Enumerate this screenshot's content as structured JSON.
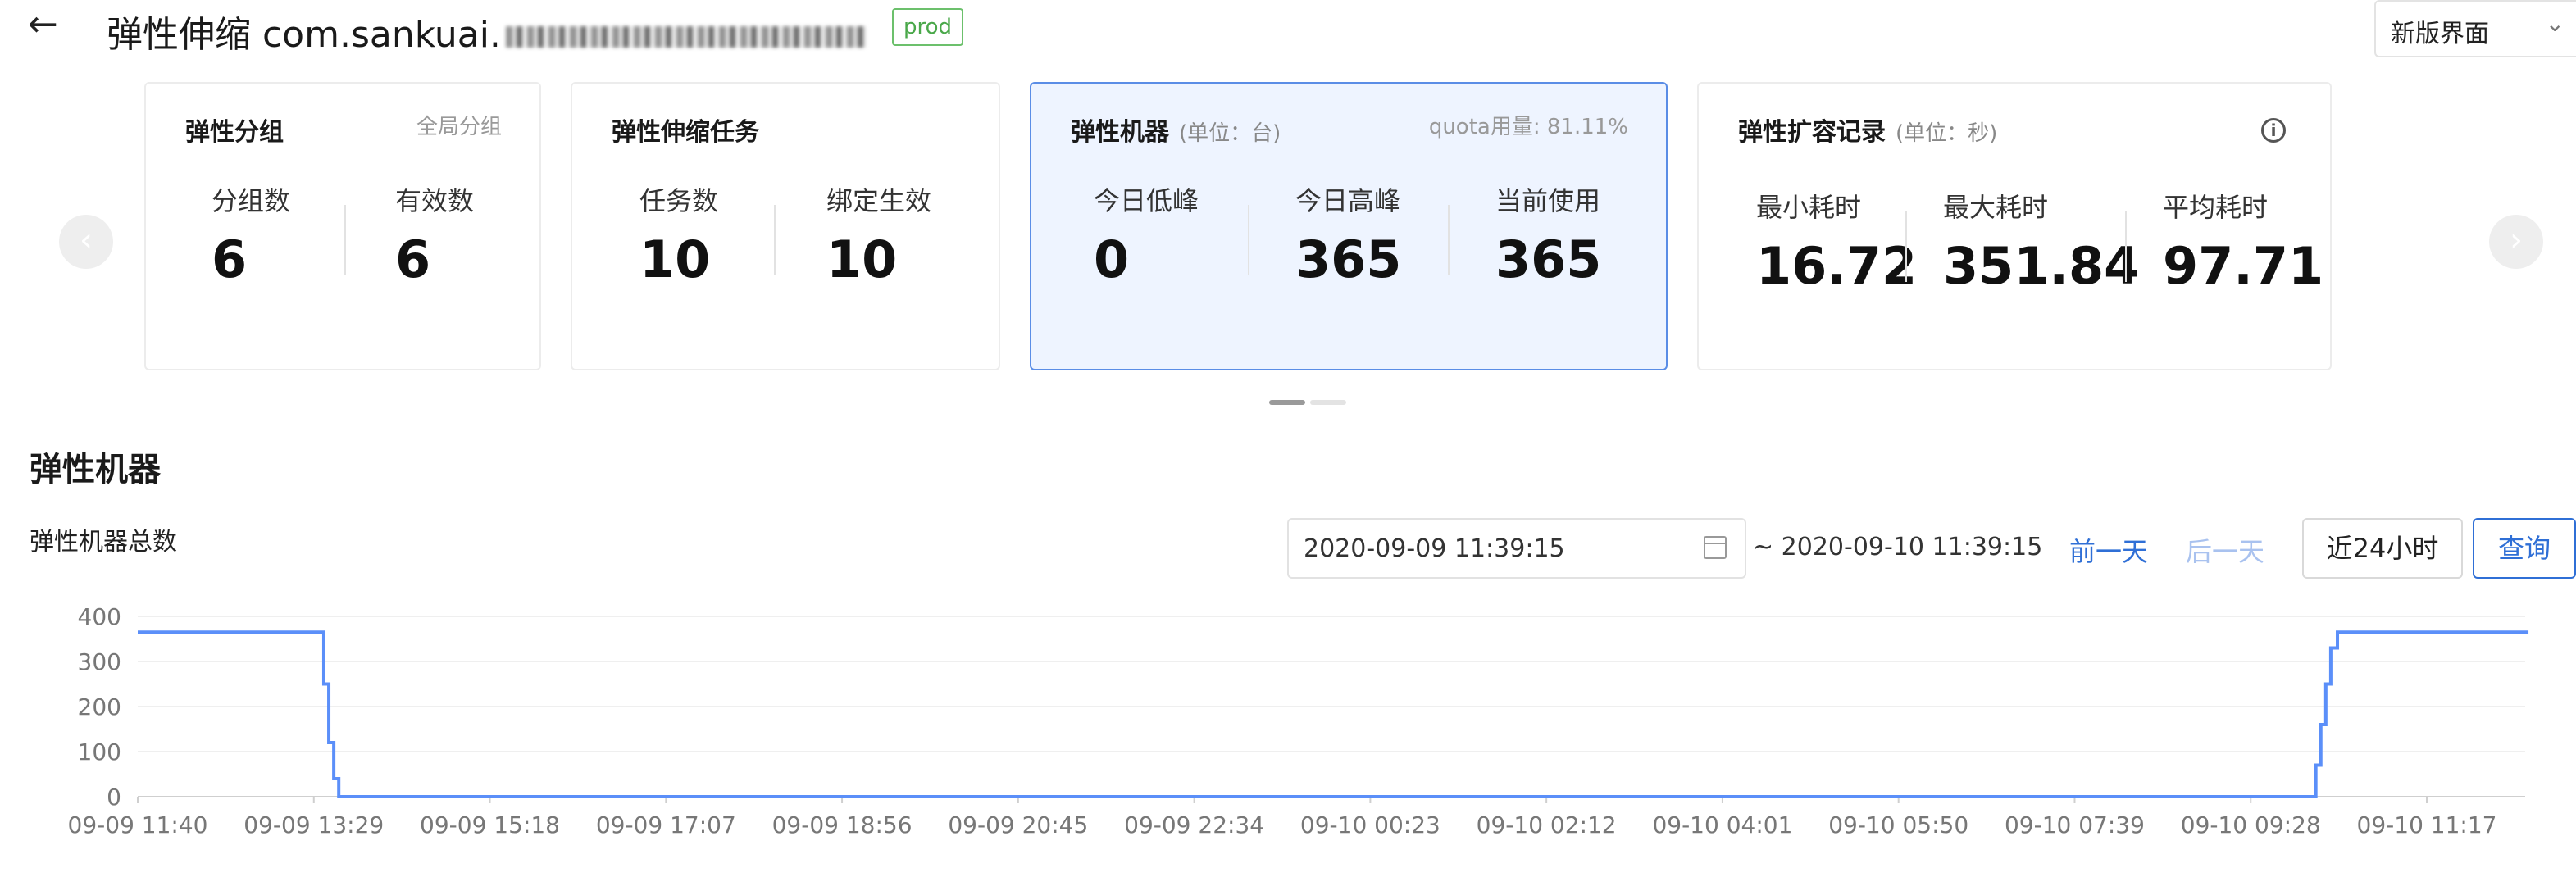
{
  "header": {
    "back_icon": "arrow-left-icon",
    "title": "弹性伸缩 com.sankuai.",
    "env_badge": "prod",
    "version_select": "新版界面"
  },
  "carousel": {
    "prev_icon": "chevron-left-icon",
    "next_icon": "chevron-right-icon",
    "cards": [
      {
        "title": "弹性分组",
        "subtitle": "全局分组",
        "metrics": [
          {
            "label": "分组数",
            "value": "6"
          },
          {
            "label": "有效数",
            "value": "6"
          }
        ]
      },
      {
        "title": "弹性伸缩任务",
        "metrics": [
          {
            "label": "任务数",
            "value": "10"
          },
          {
            "label": "绑定生效",
            "value": "10"
          }
        ]
      },
      {
        "title": "弹性机器",
        "unit": "(单位：台)",
        "subtitle": "quota用量: 81.11%",
        "metrics": [
          {
            "label": "今日低峰",
            "value": "0"
          },
          {
            "label": "今日高峰",
            "value": "365"
          },
          {
            "label": "当前使用",
            "value": "365"
          }
        ]
      },
      {
        "title": "弹性扩容记录",
        "unit": "(单位：秒)",
        "info_icon": "info-circle-icon",
        "metrics": [
          {
            "label": "最小耗时",
            "value": "16.72"
          },
          {
            "label": "最大耗时",
            "value": "351.84"
          },
          {
            "label": "平均耗时",
            "value": "97.71"
          }
        ]
      }
    ]
  },
  "section": {
    "title": "弹性机器",
    "chart_title": "弹性机器总数"
  },
  "filters": {
    "start_value": "2020-09-09 11:39:15",
    "calendar_icon": "calendar-icon",
    "range_end": "~ 2020-09-10 11:39:15",
    "prev_day": "前一天",
    "next_day": "后一天",
    "last_24h": "近24小时",
    "query": "查询"
  },
  "colors": {
    "line": "#5b8ff9",
    "accent": "#2f6fd6",
    "badge": "#4aa84a",
    "active_card_bg": "#eef4ff"
  },
  "chart_data": {
    "type": "line",
    "title": "弹性机器总数",
    "xlabel": "",
    "ylabel": "",
    "ylim": [
      0,
      400
    ],
    "yticks": [
      0,
      100,
      200,
      300,
      400
    ],
    "xticks": [
      "09-09 11:40",
      "09-09 13:29",
      "09-09 15:18",
      "09-09 17:07",
      "09-09 18:56",
      "09-09 20:45",
      "09-09 22:34",
      "09-10 00:23",
      "09-10 02:12",
      "09-10 04:01",
      "09-10 05:50",
      "09-10 07:39",
      "09-10 09:28",
      "09-10 11:17"
    ],
    "grid": true,
    "series": [
      {
        "points": [
          [
            "09-09 11:40",
            365
          ],
          [
            "09-09 13:29",
            365
          ],
          [
            "09-09 13:32",
            250
          ],
          [
            "09-09 13:35",
            120
          ],
          [
            "09-09 13:38",
            40
          ],
          [
            "09-09 13:41",
            0
          ],
          [
            "09-10 09:28",
            0
          ],
          [
            "09-10 09:31",
            70
          ],
          [
            "09-10 09:34",
            160
          ],
          [
            "09-10 09:37",
            250
          ],
          [
            "09-10 09:40",
            330
          ],
          [
            "09-10 09:44",
            365
          ],
          [
            "09-10 11:39",
            365
          ]
        ]
      }
    ]
  }
}
